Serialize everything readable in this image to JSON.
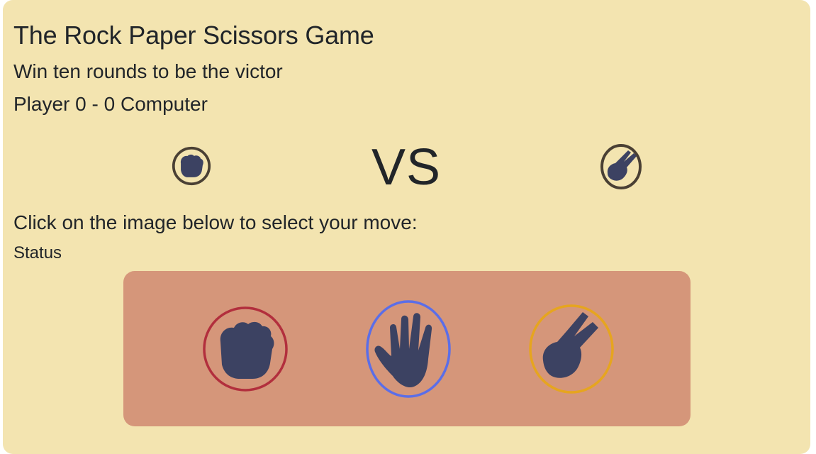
{
  "game": {
    "title": "The Rock Paper Scissors Game",
    "subtitle": "Win ten rounds to be the victor",
    "score": {
      "player_label": "Player",
      "player_score": "0",
      "separator": "-",
      "computer_score": "0",
      "computer_label": "Computer"
    },
    "vs_label": "VS",
    "player_choice_icon": "rock-icon",
    "computer_choice_icon": "scissors-icon",
    "instruction": "Click on the image below to select your move:",
    "status": "Status"
  },
  "moves": [
    {
      "name": "rock",
      "icon": "rock-icon",
      "ring_color": "#b22f3d"
    },
    {
      "name": "paper",
      "icon": "paper-icon",
      "ring_color": "#5b6ee8"
    },
    {
      "name": "scissors",
      "icon": "scissors-icon",
      "ring_color": "#e6a51f"
    }
  ],
  "colors": {
    "background": "#f3e4b0",
    "panel": "#d5967a",
    "hand": "#3c4262",
    "small_ring": "#4a4034"
  }
}
